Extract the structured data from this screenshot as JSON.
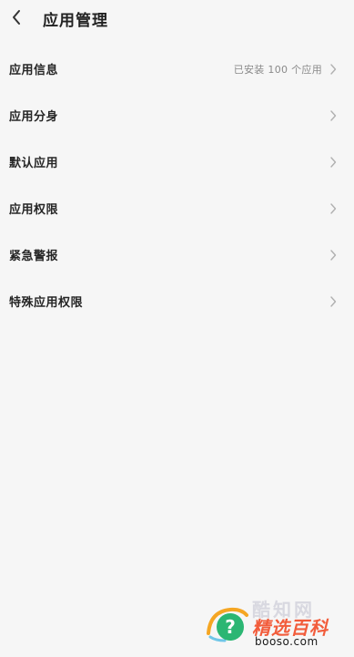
{
  "header": {
    "title": "应用管理",
    "back_icon": "chevron-left-icon"
  },
  "settings": {
    "items": [
      {
        "label": "应用信息",
        "value": "已安装 100 个应用"
      },
      {
        "label": "应用分身",
        "value": ""
      },
      {
        "label": "默认应用",
        "value": ""
      },
      {
        "label": "应用权限",
        "value": ""
      },
      {
        "label": "紧急警报",
        "value": ""
      },
      {
        "label": "特殊应用权限",
        "value": ""
      }
    ],
    "chevron_icon": "chevron-right-icon"
  },
  "watermark": {
    "top_text": "酷知网",
    "title": "精选百科",
    "url": "booso.com",
    "icon": "question-mark-icon"
  },
  "colors": {
    "background": "#f6f6f6",
    "text_primary": "#262626",
    "text_secondary": "#8a8a8a",
    "chevron": "#b0b0b0",
    "watermark_accent": "#f25c3b",
    "watermark_badge": "#2bb673"
  }
}
